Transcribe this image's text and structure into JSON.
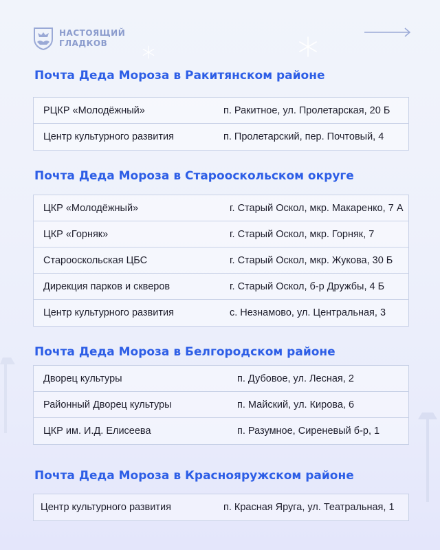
{
  "header": {
    "brand_line1": "НАСТОЯЩИЙ",
    "brand_line2": "ГЛАДКОВ",
    "logo_icon": "belgorod-coat-of-arms-icon",
    "arrow_icon": "arrow-right-icon"
  },
  "colors": {
    "accent": "#2d5ee6",
    "brand_text": "#8b9ccd",
    "border": "#c7d0e6",
    "text": "#1d1d2b"
  },
  "sections": [
    {
      "title": "Почта Деда Мороза в Ракитянском районе",
      "rows": [
        {
          "name": "РЦКР «Молодёжный»",
          "address": "п. Ракитное, ул. Пролетарская, 20 Б"
        },
        {
          "name": "Центр культурного развития",
          "address": "п. Пролетарский, пер. Почтовый, 4"
        }
      ]
    },
    {
      "title": "Почта Деда Мороза в Старооскольском округе",
      "rows": [
        {
          "name": "ЦКР «Молодёжный»",
          "address": "г. Старый Оскол, мкр. Макаренко, 7 А"
        },
        {
          "name": "ЦКР «Горняк»",
          "address": "г. Старый Оскол, мкр. Горняк, 7"
        },
        {
          "name": "Старооскольская ЦБС",
          "address": "г. Старый Оскол, мкр. Жукова, 30 Б"
        },
        {
          "name": "Дирекция парков и скверов",
          "address": "г. Старый Оскол, б-р Дружбы, 4 Б"
        },
        {
          "name": "Центр культурного развития",
          "address": "с. Незнамово, ул. Центральная, 3"
        }
      ]
    },
    {
      "title": "Почта Деда Мороза в Белгородском районе",
      "rows": [
        {
          "name": "Дворец культуры",
          "address": "п. Дубовое, ул. Лесная, 2"
        },
        {
          "name": "Районный Дворец культуры",
          "address": "п. Майский, ул. Кирова, 6"
        },
        {
          "name": "ЦКР им. И.Д. Елисеева",
          "address": "п. Разумное, Сиреневый б-р, 1"
        }
      ]
    },
    {
      "title": "Почта Деда Мороза в Краснояружском районе",
      "rows": [
        {
          "name": "Центр культурного развития",
          "address": "п. Красная Яруга, ул. Театральная, 1"
        }
      ]
    }
  ]
}
